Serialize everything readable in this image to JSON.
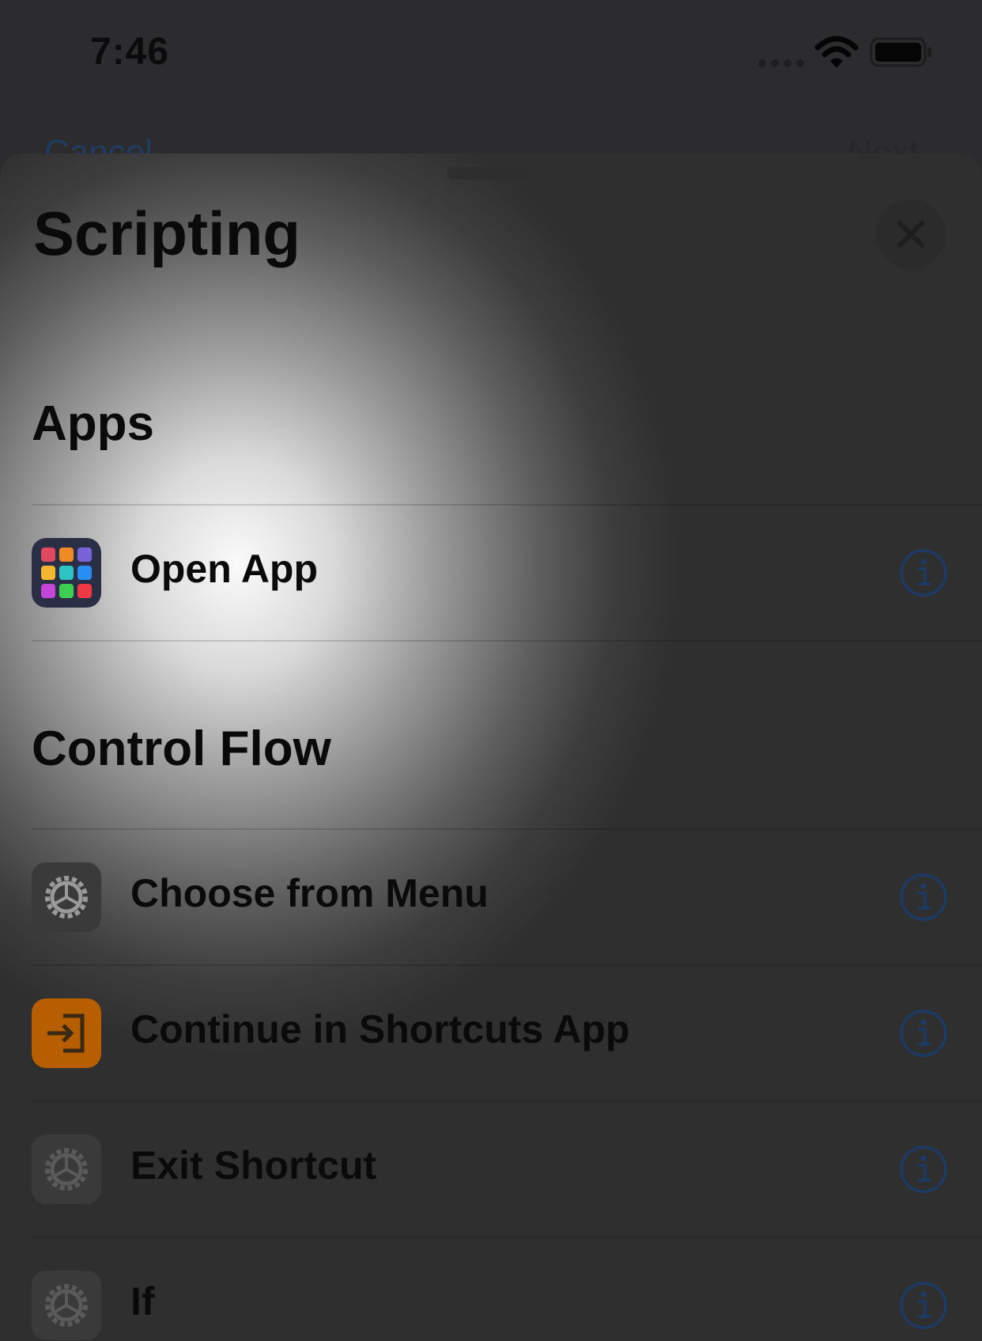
{
  "status_bar": {
    "time": "7:46",
    "wifi_icon": "wifi-icon",
    "battery_icon": "battery-full-icon"
  },
  "nav_behind": {
    "left_label": "Cancel",
    "right_label": "Next"
  },
  "sheet": {
    "title": "Scripting",
    "close_icon": "close-icon",
    "sections": [
      {
        "header": "Apps",
        "items": [
          {
            "label": "Open App",
            "icon": "app-grid-icon",
            "info_icon": "info-icon"
          }
        ]
      },
      {
        "header": "Control Flow",
        "items": [
          {
            "label": "Choose from Menu",
            "icon": "gear-icon",
            "info_icon": "info-icon"
          },
          {
            "label": "Continue in Shortcuts App",
            "icon": "enter-arrow-icon",
            "info_icon": "info-icon"
          },
          {
            "label": "Exit Shortcut",
            "icon": "gear-icon",
            "info_icon": "info-icon"
          },
          {
            "label": "If",
            "icon": "gear-icon",
            "info_icon": "info-icon"
          }
        ]
      }
    ]
  },
  "colors": {
    "accent_blue": "#1c3a66",
    "orange_icon": "#b75e00",
    "gray_icon": "#3a3a3a"
  }
}
